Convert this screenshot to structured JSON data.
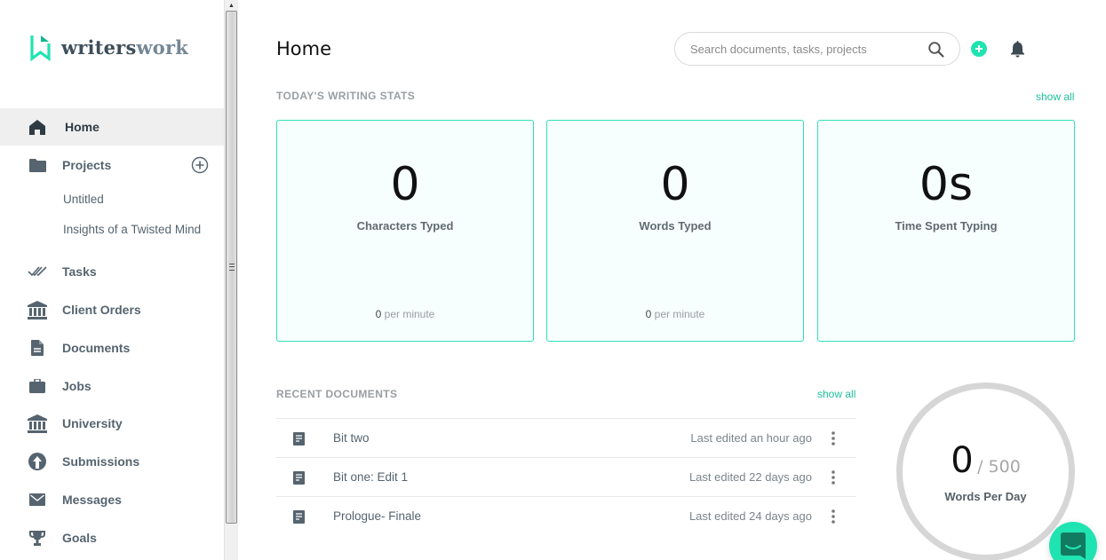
{
  "app": {
    "logo_part1": "writers",
    "logo_part2": "work",
    "colors": {
      "accent": "#20e3b2",
      "accent_text": "#1dbf9b",
      "card_border": "#30e0b8",
      "icon": "#55646f"
    }
  },
  "sidebar": {
    "items": [
      {
        "label": "Home",
        "icon": "home-icon",
        "active": true
      },
      {
        "label": "Projects",
        "icon": "folder-icon"
      },
      {
        "label": "Tasks",
        "icon": "double-check-icon"
      },
      {
        "label": "Client Orders",
        "icon": "bank-icon"
      },
      {
        "label": "Documents",
        "icon": "document-icon"
      },
      {
        "label": "Jobs",
        "icon": "briefcase-icon"
      },
      {
        "label": "University",
        "icon": "university-icon"
      },
      {
        "label": "Submissions",
        "icon": "upload-circle-icon"
      },
      {
        "label": "Messages",
        "icon": "envelope-icon"
      },
      {
        "label": "Goals",
        "icon": "trophy-icon"
      }
    ],
    "projects": [
      "Untitled",
      "Insights of a Twisted Mind"
    ]
  },
  "header": {
    "title": "Home",
    "search_placeholder": "Search documents, tasks, projects"
  },
  "stats": {
    "section_title": "TODAY'S WRITING STATS",
    "show_all": "show all",
    "cards": [
      {
        "value": "0",
        "caption": "Characters Typed",
        "rate_value": "0",
        "rate_unit": "per minute"
      },
      {
        "value": "0",
        "caption": "Words Typed",
        "rate_value": "0",
        "rate_unit": "per minute"
      },
      {
        "value": "0s",
        "caption": "Time Spent Typing"
      }
    ]
  },
  "recent": {
    "section_title": "RECENT DOCUMENTS",
    "show_all": "show all",
    "documents": [
      {
        "name": "Bit two",
        "edited": "Last edited an hour ago"
      },
      {
        "name": "Bit one: Edit 1",
        "edited": "Last edited 22 days ago"
      },
      {
        "name": "Prologue- Finale",
        "edited": "Last edited 24 days ago"
      }
    ]
  },
  "goal": {
    "current": "0",
    "target": "/ 500",
    "label": "Words Per Day",
    "progress_fraction": 0
  }
}
